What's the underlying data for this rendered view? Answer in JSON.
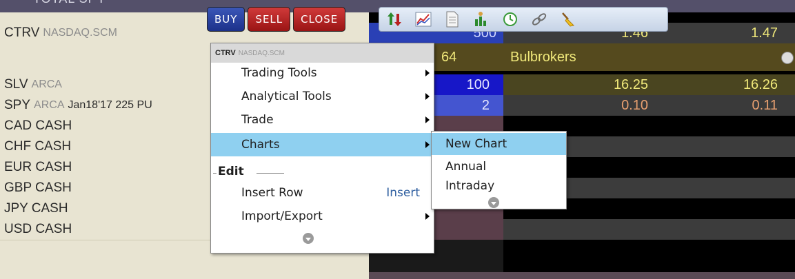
{
  "toolbar": {
    "buy_label": "BUY",
    "sell_label": "SELL",
    "close_label": "CLOSE",
    "icons": [
      "up-down-arrows-icon",
      "chart-line-icon",
      "document-icon",
      "bar-chart-person-icon",
      "clock-dollar-icon",
      "chain-link-icon",
      "broom-icon"
    ]
  },
  "total_row": {
    "label": "TOTAL  SPY"
  },
  "rows": [
    {
      "symbol": "CTRV",
      "exchange": "NASDAQ.SCM",
      "extra": ""
    },
    {
      "symbol": "",
      "exchange": "",
      "extra": ""
    },
    {
      "symbol": "SLV",
      "exchange": "ARCA",
      "extra": ""
    },
    {
      "symbol": "SPY",
      "exchange": "ARCA",
      "extra": "Jan18'17 225 PU"
    },
    {
      "symbol": "CAD CASH",
      "exchange": "",
      "extra": ""
    },
    {
      "symbol": "CHF CASH",
      "exchange": "",
      "extra": ""
    },
    {
      "symbol": "EUR CASH",
      "exchange": "",
      "extra": ""
    },
    {
      "symbol": "GBP CASH",
      "exchange": "",
      "extra": ""
    },
    {
      "symbol": "JPY CASH",
      "exchange": "",
      "extra": ""
    },
    {
      "symbol": "USD CASH",
      "exchange": "",
      "extra": ""
    }
  ],
  "data_cells": {
    "row0_qty": "500",
    "row0_bid": "1.46",
    "row0_ask": "1.47",
    "row1_num": "64",
    "row1_broker": "Bulbrokers",
    "row2_qty": "100",
    "row2_bid": "16.25",
    "row2_ask": "16.26",
    "row3_qty": "2",
    "row3_bid": "0.10",
    "row3_ask": "0.11"
  },
  "colors": {
    "sell_red": "#d13a3a",
    "buy_blue": "#1c318a",
    "menu_highlight": "#8fd0f0",
    "bid_yellow": "#f0e87a",
    "ask_orange": "#e8a070"
  },
  "context_menu": {
    "header_symbol": "CTRV",
    "header_exchange": "NASDAQ.SCM",
    "items": [
      {
        "label": "Trading Tools",
        "has_submenu": true
      },
      {
        "label": "Analytical Tools",
        "has_submenu": true
      },
      {
        "label": "Trade",
        "has_submenu": true
      },
      {
        "label": "Charts",
        "has_submenu": true,
        "highlighted": true
      }
    ],
    "edit_section_label": "Edit",
    "edit_items": [
      {
        "label": "Insert Row",
        "shortcut": "Insert"
      },
      {
        "label": "Import/Export",
        "has_submenu": true
      }
    ]
  },
  "charts_submenu": {
    "items": [
      {
        "label": "New Chart",
        "highlighted": true
      },
      {
        "label": "Annual"
      },
      {
        "label": "Intraday"
      }
    ]
  }
}
